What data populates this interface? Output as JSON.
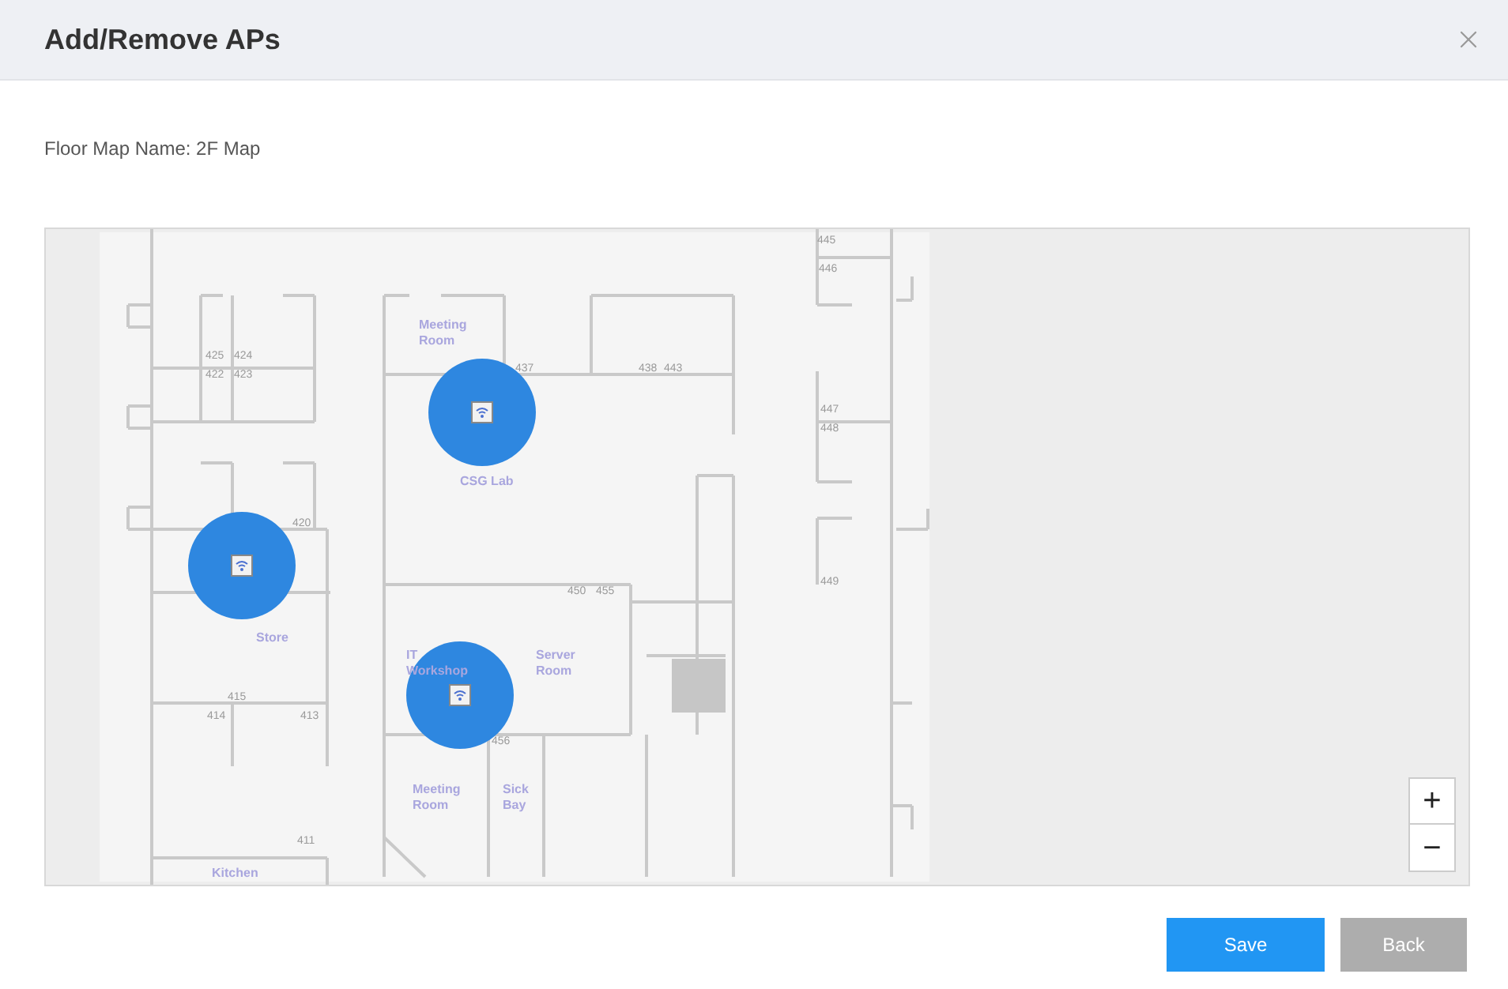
{
  "dialog": {
    "title": "Add/Remove APs"
  },
  "floor_map_name": "Floor Map Name: 2F Map",
  "map": {
    "labels": [
      {
        "kind": "room",
        "text": "Meeting Room"
      },
      {
        "kind": "number",
        "text": "425"
      },
      {
        "kind": "number",
        "text": "424"
      },
      {
        "kind": "number",
        "text": "422"
      },
      {
        "kind": "number",
        "text": "423"
      },
      {
        "kind": "number",
        "text": "437"
      },
      {
        "kind": "number",
        "text": "438"
      },
      {
        "kind": "number",
        "text": "443"
      },
      {
        "kind": "number",
        "text": "445"
      },
      {
        "kind": "number",
        "text": "446"
      },
      {
        "kind": "number",
        "text": "447"
      },
      {
        "kind": "number",
        "text": "448"
      },
      {
        "kind": "room",
        "text": "CSG Lab"
      },
      {
        "kind": "number",
        "text": "420"
      },
      {
        "kind": "number",
        "text": "450"
      },
      {
        "kind": "number",
        "text": "455"
      },
      {
        "kind": "number",
        "text": "449"
      },
      {
        "kind": "room",
        "text": "Store"
      },
      {
        "kind": "room",
        "text": "IT Workshop"
      },
      {
        "kind": "room",
        "text": "Server Room"
      },
      {
        "kind": "number",
        "text": "415"
      },
      {
        "kind": "number",
        "text": "414"
      },
      {
        "kind": "number",
        "text": "413"
      },
      {
        "kind": "number",
        "text": "456"
      },
      {
        "kind": "room",
        "text": "Meeting Room"
      },
      {
        "kind": "room",
        "text": "Sick Bay"
      },
      {
        "kind": "number",
        "text": "411"
      },
      {
        "kind": "room",
        "text": "Kitchen"
      }
    ],
    "zoom_in": "+",
    "zoom_out": "−"
  },
  "buttons": [
    {
      "kind": "primary",
      "label": "Save"
    },
    {
      "kind": "secondary",
      "label": "Back"
    }
  ]
}
